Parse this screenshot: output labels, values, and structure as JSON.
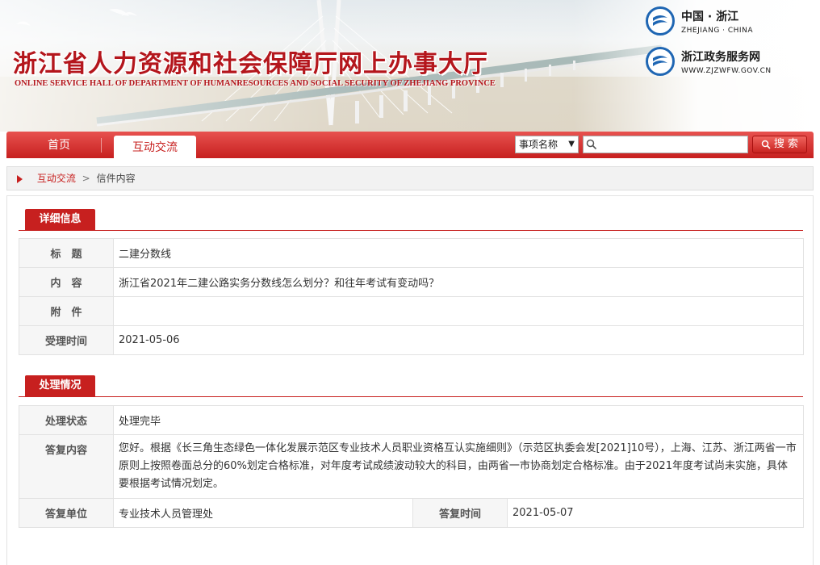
{
  "header": {
    "title": "浙江省人力资源和社会保障厅网上办事大厅",
    "subtitle": "ONLINE SERVICE HALL OF DEPARTMENT OF HUMANRESOURCES AND SOCIAL SECURITY OF ZHEJIANG PROVINCE",
    "logo1": {
      "name": "中国 · 浙江",
      "sub": "ZHEJIANG · CHINA"
    },
    "logo2": {
      "name": "浙江政务服务网",
      "sub": "WWW.ZJZWFW.GOV.CN"
    }
  },
  "nav": {
    "home": "首页",
    "active": "互动交流",
    "select_value": "事项名称",
    "search_value": "",
    "search_button": "搜 索"
  },
  "breadcrumb": {
    "link": "互动交流",
    "separator": ">",
    "current": "信件内容"
  },
  "detail": {
    "heading": "详细信息",
    "rows": [
      {
        "label": "标　题",
        "value": "二建分数线"
      },
      {
        "label": "内　容",
        "value": "浙江省2021年二建公路实务分数线怎么划分？和往年考试有变动吗？"
      },
      {
        "label": "附　件",
        "value": ""
      },
      {
        "label": "受理时间",
        "value": "2021-05-06"
      }
    ]
  },
  "handling": {
    "heading": "处理情况",
    "status_label": "处理状态",
    "status_value": "处理完毕",
    "reply_label": "答复内容",
    "reply_value": "您好。根据《长三角生态绿色一体化发展示范区专业技术人员职业资格互认实施细则》（示范区执委会发[2021]10号），上海、江苏、浙江两省一市原则上按照卷面总分的60%划定合格标准，对年度考试成绩波动较大的科目，由两省一市协商划定合格标准。由于2021年度考试尚未实施，具体要根据考试情况划定。",
    "unit_label": "答复单位",
    "unit_value": "专业技术人员管理处",
    "time_label": "答复时间",
    "time_value": "2021-05-07"
  },
  "colors": {
    "brand_red": "#c7201f",
    "label_bg": "#f6f6f6"
  }
}
